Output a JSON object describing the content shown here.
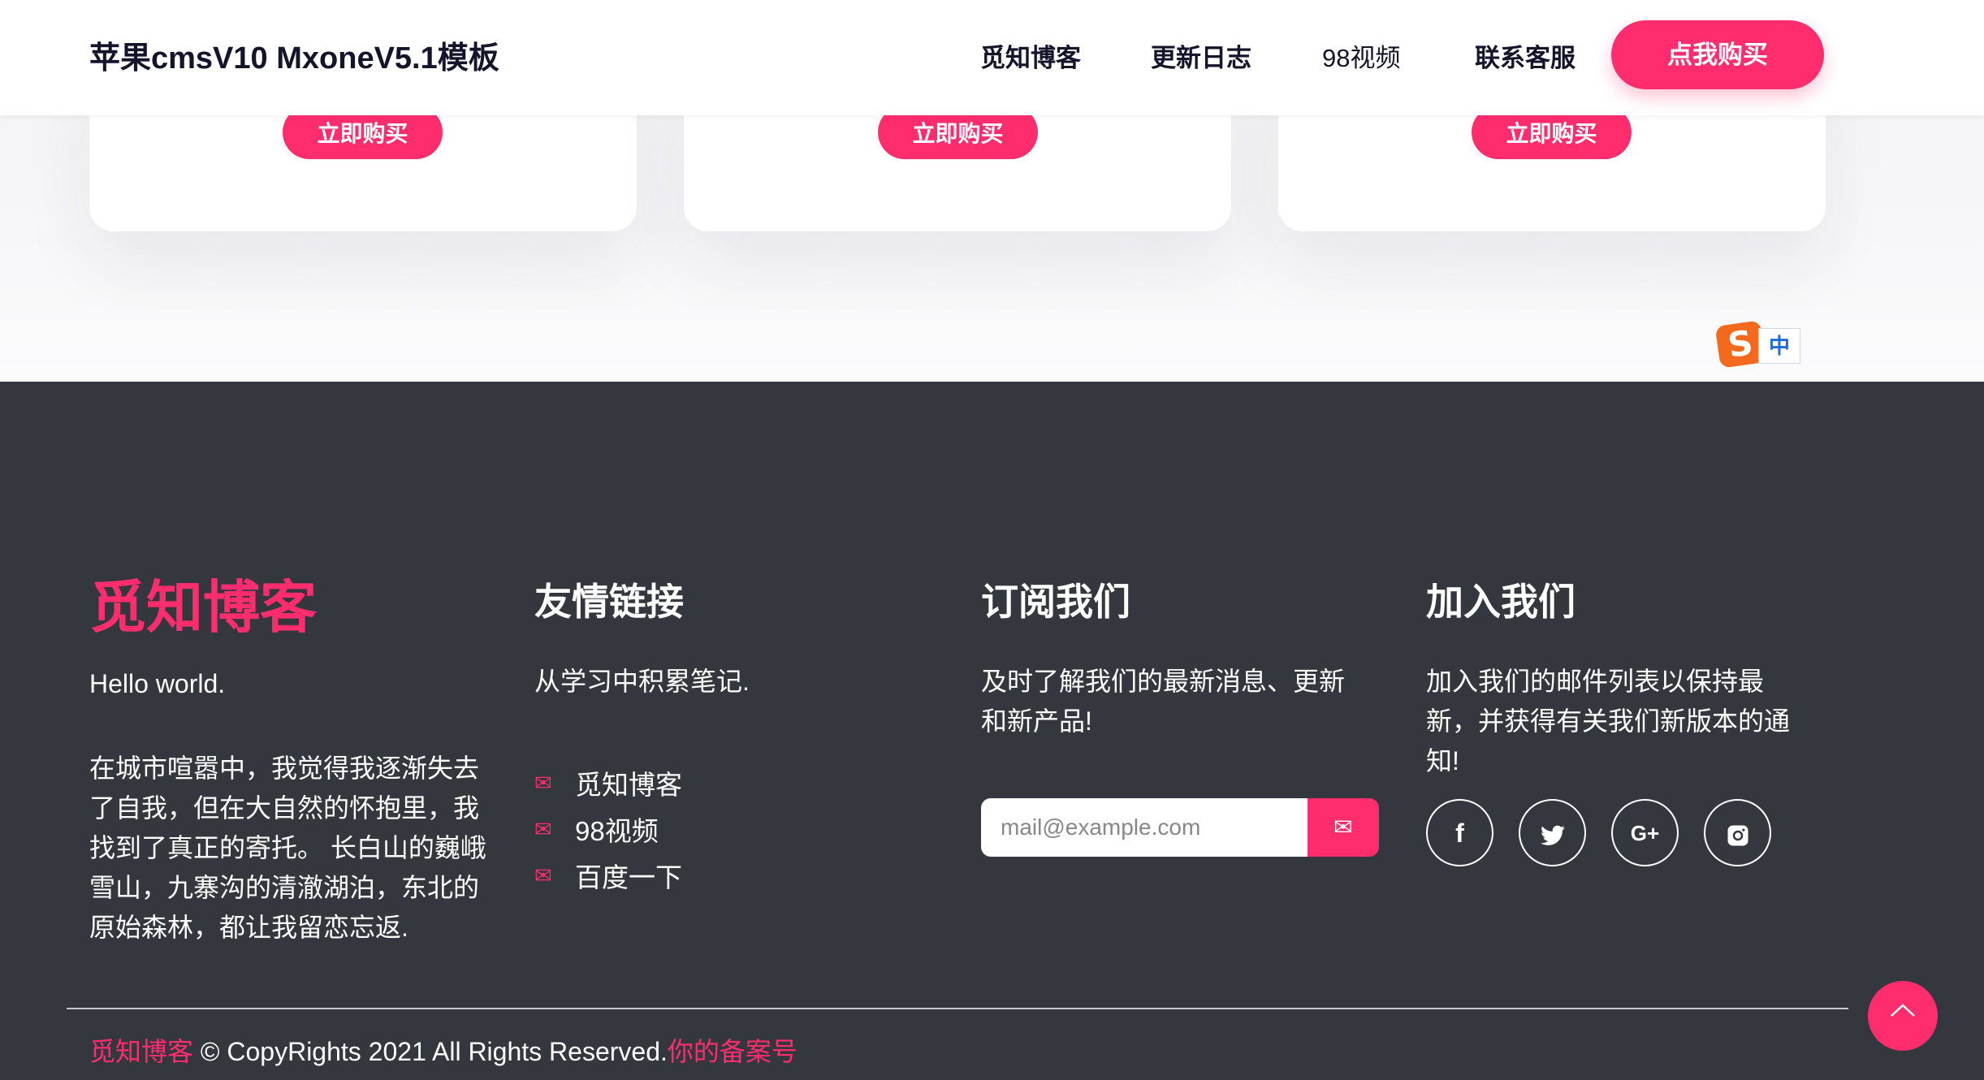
{
  "header": {
    "logo": "苹果cmsV10 MxoneV5.1模板",
    "nav": [
      "觅知博客",
      "更新日志",
      "98视频",
      "联系客服"
    ],
    "buy_button": "点我购买"
  },
  "pricing_cards": {
    "button_label": "立即购买"
  },
  "ime_indicator": {
    "logo_letter": "S",
    "mode": "中"
  },
  "footer": {
    "brand": "觅知博客",
    "about": {
      "tagline": "Hello world.",
      "description": "在城市喧嚣中，我觉得我逐渐失去了自我，但在大自然的怀抱里，我找到了真正的寄托。 长白山的巍峨雪山，九寨沟的清澈湖泊，东北的原始森林，都让我留恋忘返."
    },
    "links": {
      "title": "友情链接",
      "subtitle": "从学习中积累笔记.",
      "items": [
        "觅知博客",
        "98视频",
        "百度一下"
      ]
    },
    "subscribe": {
      "title": "订阅我们",
      "text": "及时了解我们的最新消息、更新和新产品!",
      "placeholder": "mail@example.com"
    },
    "join": {
      "title": "加入我们",
      "text": "加入我们的邮件列表以保持最新，并获得有关我们新版本的通知!",
      "social_icons": [
        "facebook-icon",
        "twitter-icon",
        "google-plus-icon",
        "instagram-icon"
      ]
    },
    "copyright": {
      "brand": "觅知博客",
      "text": " © CopyRights 2021 All Rights Reserved.",
      "icp": "你的备案号"
    }
  },
  "colors": {
    "accent": "#ff2d6e",
    "footer_bg": "#34373e",
    "nav_text": "#14142b"
  }
}
